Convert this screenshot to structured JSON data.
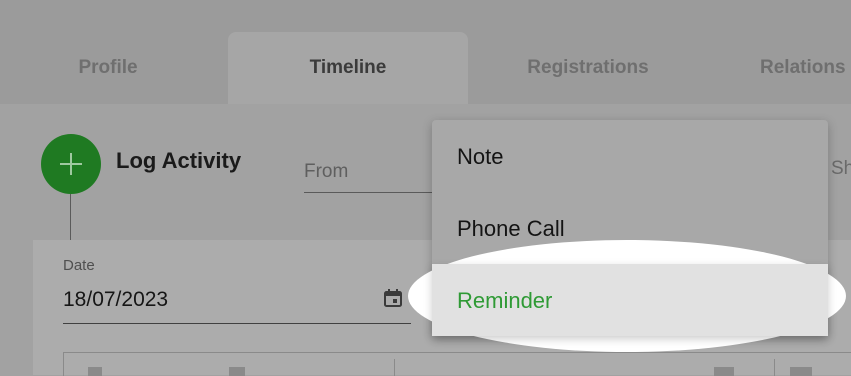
{
  "tabs": [
    {
      "label": "Profile",
      "active": false
    },
    {
      "label": "Timeline",
      "active": true
    },
    {
      "label": "Registrations",
      "active": false
    },
    {
      "label": "Relations",
      "active": false
    }
  ],
  "log_activity": {
    "title": "Log Activity",
    "icon": "plus-icon",
    "fab_color": "#1f7a22"
  },
  "filters": {
    "from_placeholder": "From",
    "show_text": "Sh"
  },
  "form": {
    "date_label": "Date",
    "date_value": "18/07/2023",
    "date_icon": "calendar-icon"
  },
  "menu": {
    "items": [
      {
        "label": "Note"
      },
      {
        "label": "Phone Call"
      },
      {
        "label": "Reminder",
        "highlighted": true
      }
    ],
    "highlight_color": "#2f9a35"
  }
}
